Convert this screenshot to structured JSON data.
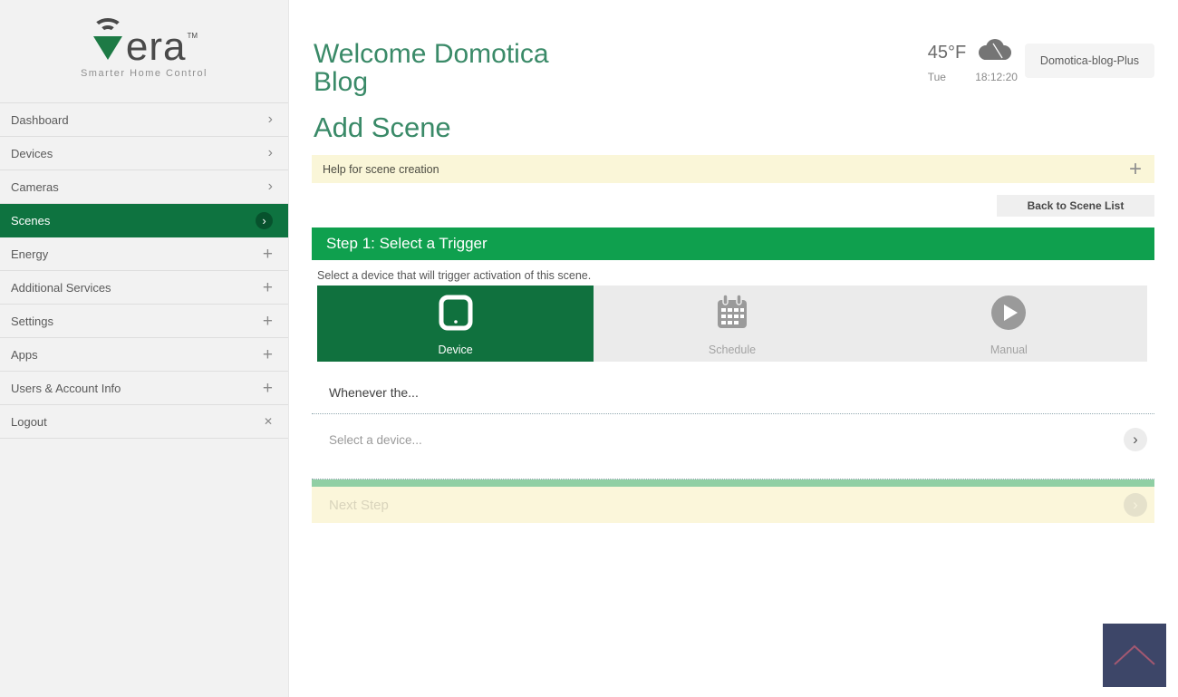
{
  "icons": {
    "chevron_right": "›",
    "plus": "+",
    "close": "✕"
  },
  "brand": {
    "name_rest": "era",
    "tm": "TM",
    "tagline": "Smarter Home Control"
  },
  "sidebar": {
    "items": [
      {
        "label": "Dashboard"
      },
      {
        "label": "Devices"
      },
      {
        "label": "Cameras"
      },
      {
        "label": "Scenes",
        "active": true
      },
      {
        "label": "Energy"
      },
      {
        "label": "Additional Services"
      },
      {
        "label": "Settings"
      },
      {
        "label": "Apps"
      },
      {
        "label": "Users & Account Info"
      },
      {
        "label": "Logout"
      }
    ]
  },
  "header": {
    "welcome": "Welcome Domotica Blog",
    "temperature": "45°F",
    "day": "Tue",
    "time": "18:12:20",
    "controller": "Domotica-blog-Plus"
  },
  "scene": {
    "title": "Add Scene",
    "help": "Help for scene creation",
    "back": "Back to Scene List",
    "step_title": "Step 1: Select a Trigger",
    "step_desc": "Select a device that will trigger activation of this scene.",
    "triggers": [
      {
        "label": "Device",
        "selected": true
      },
      {
        "label": "Schedule",
        "selected": false
      },
      {
        "label": "Manual",
        "selected": false
      }
    ],
    "whenever": "Whenever the...",
    "select_device": "Select a device...",
    "next_step": "Next Step"
  },
  "colors": {
    "accent_green": "#0fa04e",
    "selected_green": "#10713e",
    "heading_green": "#3a8a68",
    "help_yellow": "#faf6d8",
    "soft_green_bar": "#90cfa4",
    "scrolltop_navy": "#3d4668"
  }
}
